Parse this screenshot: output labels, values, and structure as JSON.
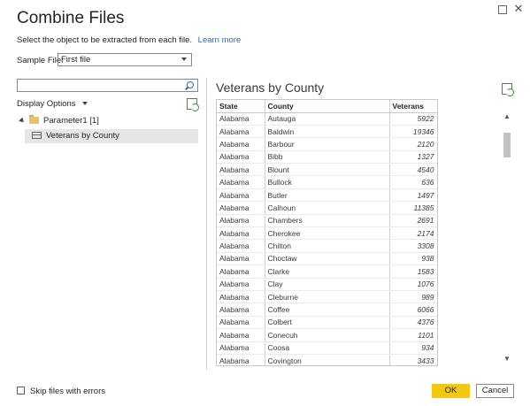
{
  "window": {
    "maximize_glyph": "",
    "close_glyph": "✕"
  },
  "dialog": {
    "title": "Combine Files",
    "subtitle": "Select the object to be extracted from each file.",
    "learn_more": "Learn more"
  },
  "sample_file": {
    "label": "Sample File:",
    "value": "First file"
  },
  "navigator": {
    "search_placeholder": "",
    "display_options": "Display Options",
    "folder_label": "Parameter1 [1]",
    "item_label": "Veterans by County"
  },
  "preview": {
    "title": "Veterans by County",
    "columns": [
      "State",
      "County",
      "Veterans"
    ],
    "rows": [
      [
        "Alabama",
        "Autauga",
        "5922"
      ],
      [
        "Alabama",
        "Baldwin",
        "19346"
      ],
      [
        "Alabama",
        "Barbour",
        "2120"
      ],
      [
        "Alabama",
        "Bibb",
        "1327"
      ],
      [
        "Alabama",
        "Blount",
        "4540"
      ],
      [
        "Alabama",
        "Bullock",
        "636"
      ],
      [
        "Alabama",
        "Butler",
        "1497"
      ],
      [
        "Alabama",
        "Calhoun",
        "11385"
      ],
      [
        "Alabama",
        "Chambers",
        "2691"
      ],
      [
        "Alabama",
        "Cherokee",
        "2174"
      ],
      [
        "Alabama",
        "Chilton",
        "3308"
      ],
      [
        "Alabama",
        "Choctaw",
        "938"
      ],
      [
        "Alabama",
        "Clarke",
        "1583"
      ],
      [
        "Alabama",
        "Clay",
        "1076"
      ],
      [
        "Alabama",
        "Cleburne",
        "989"
      ],
      [
        "Alabama",
        "Coffee",
        "6066"
      ],
      [
        "Alabama",
        "Colbert",
        "4376"
      ],
      [
        "Alabama",
        "Conecuh",
        "1101"
      ],
      [
        "Alabama",
        "Coosa",
        "934"
      ],
      [
        "Alabama",
        "Covington",
        "3433"
      ]
    ]
  },
  "scroll": {
    "up_glyph": "▲",
    "down_glyph": "▼"
  },
  "footer": {
    "skip_label": "Skip files with errors",
    "ok_label": "OK",
    "cancel_label": "Cancel"
  },
  "colors": {
    "accent": "#f2c811",
    "link": "#1f6fb5",
    "selection": "#e6e6e6"
  },
  "icons": [
    "maximize-icon",
    "close-icon",
    "search-icon",
    "refresh-icon",
    "folder-icon",
    "table-icon",
    "chevron-down-icon",
    "expand-triangle-icon"
  ]
}
